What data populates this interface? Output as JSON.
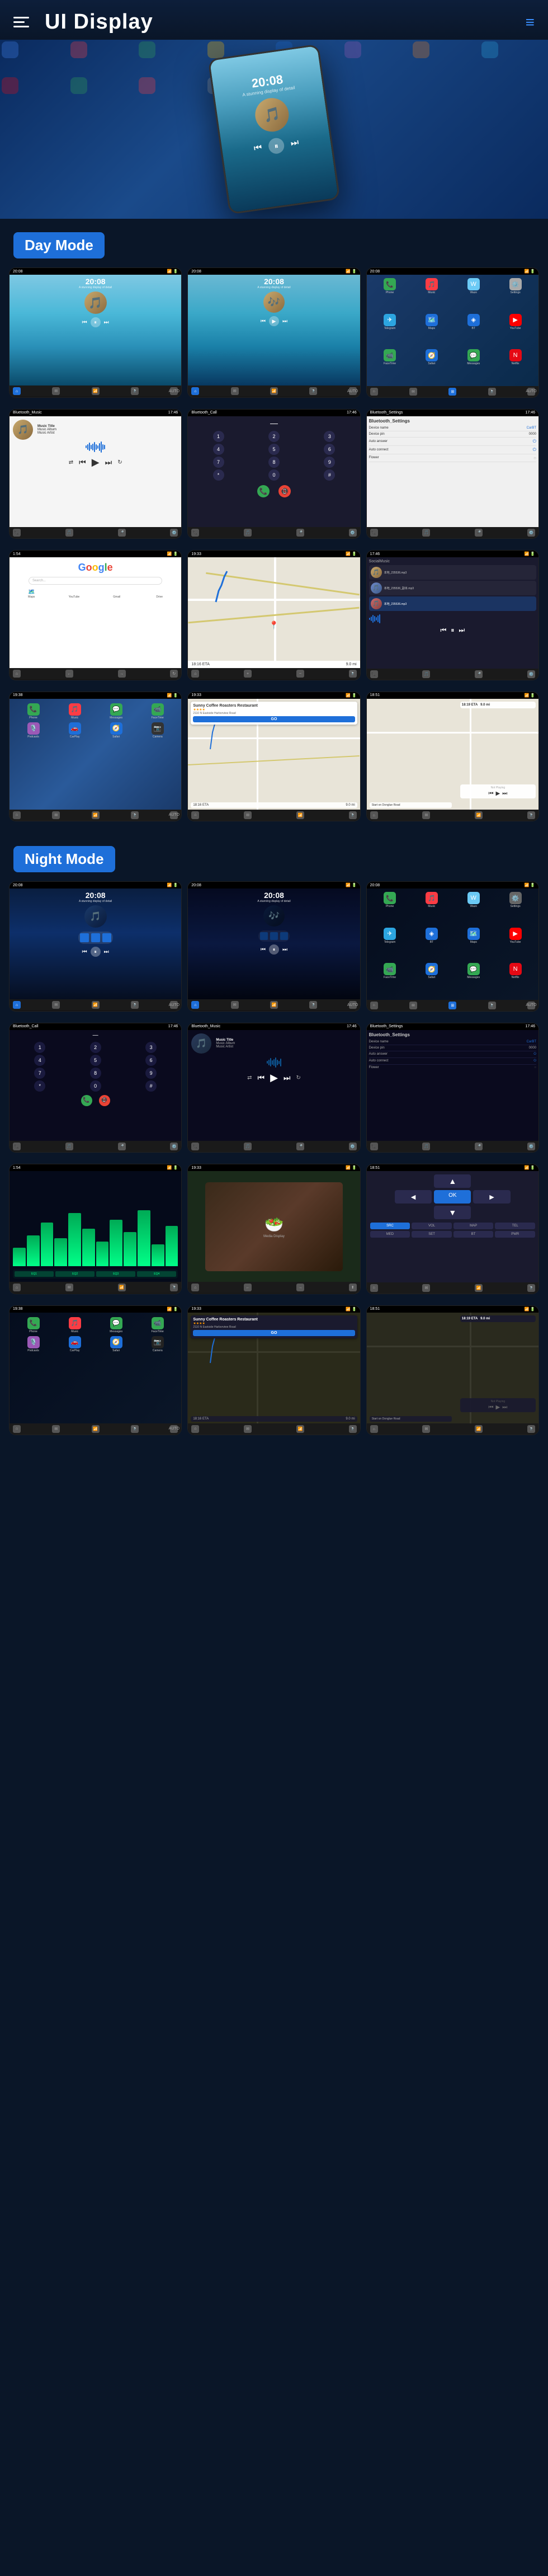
{
  "header": {
    "title": "UI Display",
    "menu_label": "menu",
    "nav_icon": "≡"
  },
  "sections": {
    "day_mode": {
      "label": "Day Mode"
    },
    "night_mode": {
      "label": "Night Mode"
    }
  },
  "hero": {
    "time": "20:08",
    "subtitle": "A stunning display of detail"
  },
  "music_player": {
    "time": "20:08",
    "subtitle": "A stunning display of detail",
    "title": "Music Title",
    "album": "Music Album",
    "artist": "Music Artist"
  },
  "bluetooth": {
    "title": "Bluetooth_Music",
    "call_title": "Bluetooth_Call",
    "settings_title": "Bluetooth_Settings"
  },
  "settings": {
    "device_name_label": "Device name",
    "device_name_value": "CarBT",
    "device_pin_label": "Device pin",
    "device_pin_value": "0000",
    "auto_answer_label": "Auto answer",
    "auto_connect_label": "Auto connect",
    "flower_label": "Flower"
  },
  "navigation": {
    "coffee_shop": "Sunny Coffee Roasters Restaurant",
    "coffee_rating": "★★★★",
    "coffee_address": "2110 N Eastside Harborview Road",
    "eta_label": "18:16 ETA",
    "distance_label": "GO",
    "map_instruction": "Start on Donglue Road",
    "total_distance": "9.0 mi",
    "not_playing": "Not Playing"
  },
  "apps": {
    "phone": {
      "icon": "📞",
      "color": "#34a853",
      "label": "Phone"
    },
    "music": {
      "icon": "🎵",
      "color": "#fc3c44",
      "label": "Music"
    },
    "maps": {
      "icon": "🗺️",
      "color": "#1e6fd9",
      "label": "Maps"
    },
    "settings": {
      "icon": "⚙️",
      "color": "#aaa",
      "label": "Settings"
    },
    "messages": {
      "icon": "💬",
      "color": "#34a853",
      "label": "Messages"
    },
    "safari": {
      "icon": "🧭",
      "color": "#1e6fd9",
      "label": "Safari"
    },
    "camera": {
      "icon": "📷",
      "color": "#333",
      "label": "Camera"
    },
    "youtube": {
      "icon": "▶",
      "color": "#ff0000",
      "label": "YouTube"
    },
    "carplay": {
      "icon": "🚗",
      "color": "#1e6fd9",
      "label": "CarPlay"
    },
    "podcasts": {
      "icon": "🎙️",
      "color": "#9b59b6",
      "label": "Podcasts"
    },
    "facetime": {
      "icon": "📹",
      "color": "#34a853",
      "label": "FaceTime"
    },
    "bt": {
      "icon": "◈",
      "color": "#1e6fd9",
      "label": "BT"
    },
    "waze": {
      "icon": "W",
      "color": "#6bcaf5",
      "label": "Waze"
    },
    "telegram": {
      "icon": "✈",
      "color": "#2ca5e0",
      "label": "Telegram"
    },
    "netflix": {
      "icon": "N",
      "color": "#e50914",
      "label": "Netflix"
    }
  },
  "dial_buttons": [
    "1",
    "2",
    "3",
    "4",
    "5",
    "6",
    "7",
    "8",
    "9",
    "*",
    "0",
    "#"
  ],
  "local_music": {
    "title": "本地_235536.mp3",
    "subtitle": "本地_235536_副本.mp3",
    "third": "本地_235536.mp3"
  },
  "colors": {
    "primary": "#1e6fd9",
    "day_mode_label": "#1e6fd9",
    "night_mode_label": "#1e6fd9",
    "accent_green": "#34a853",
    "accent_red": "#ea4335",
    "bg_dark": "#0a1628"
  }
}
